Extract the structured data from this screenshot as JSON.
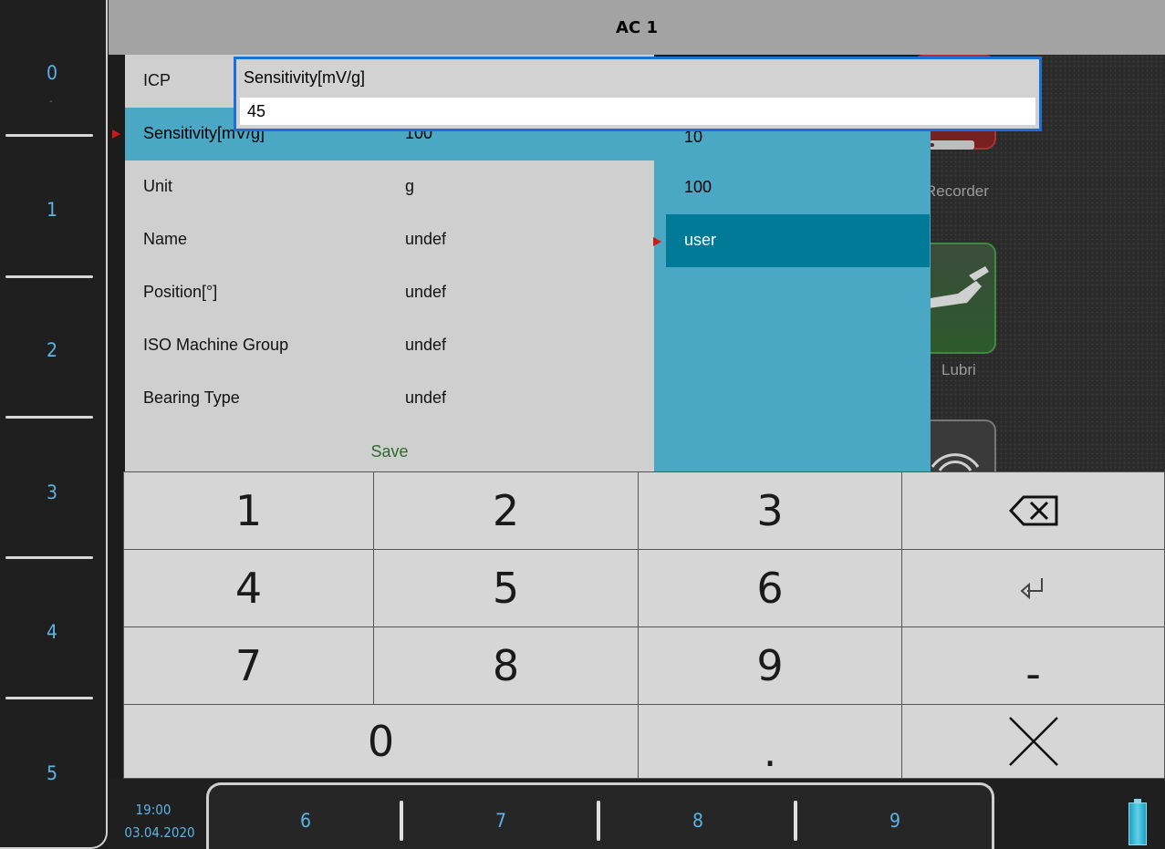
{
  "header": {
    "title": "AC 1"
  },
  "function_keys": {
    "left": [
      "0",
      "1",
      "2",
      "3",
      "4",
      "5"
    ],
    "left_0_sub": "-",
    "bottom": [
      "6",
      "7",
      "8",
      "9"
    ]
  },
  "settings": {
    "rows": [
      {
        "label": "ICP",
        "value": ""
      },
      {
        "label": "Sensitivity[mV/g]",
        "value": "100"
      },
      {
        "label": "Unit",
        "value": "g"
      },
      {
        "label": "Name",
        "value": "undef"
      },
      {
        "label": "Position[°]",
        "value": "undef"
      },
      {
        "label": "ISO Machine Group",
        "value": "undef"
      },
      {
        "label": "Bearing Type",
        "value": "undef"
      }
    ],
    "save_label": "Save",
    "selected_row": "Sensitivity[mV/g]"
  },
  "options": {
    "items": [
      "10",
      "100",
      "user"
    ],
    "selected": "user"
  },
  "popup": {
    "title": "Sensitivity[mV/g]",
    "value": "45"
  },
  "keypad": {
    "keys": [
      "1",
      "2",
      "3",
      "4",
      "5",
      "6",
      "7",
      "8",
      "9",
      "0",
      ".",
      "-"
    ],
    "icons": [
      "backspace-icon",
      "enter-icon",
      "close-icon"
    ]
  },
  "background_tiles": {
    "labels": [
      "Recorder",
      "Lubri"
    ]
  },
  "status": {
    "time": "19:00",
    "date": "03.04.2020",
    "battery": "battery-icon"
  },
  "colors": {
    "selection_blue": "#4aa8c4",
    "option_selected": "#007a96",
    "popup_border": "#1a6fd8",
    "fkey_text": "#5ab4e4",
    "save_green": "#2e6a2e",
    "marker_red": "#d01818"
  }
}
